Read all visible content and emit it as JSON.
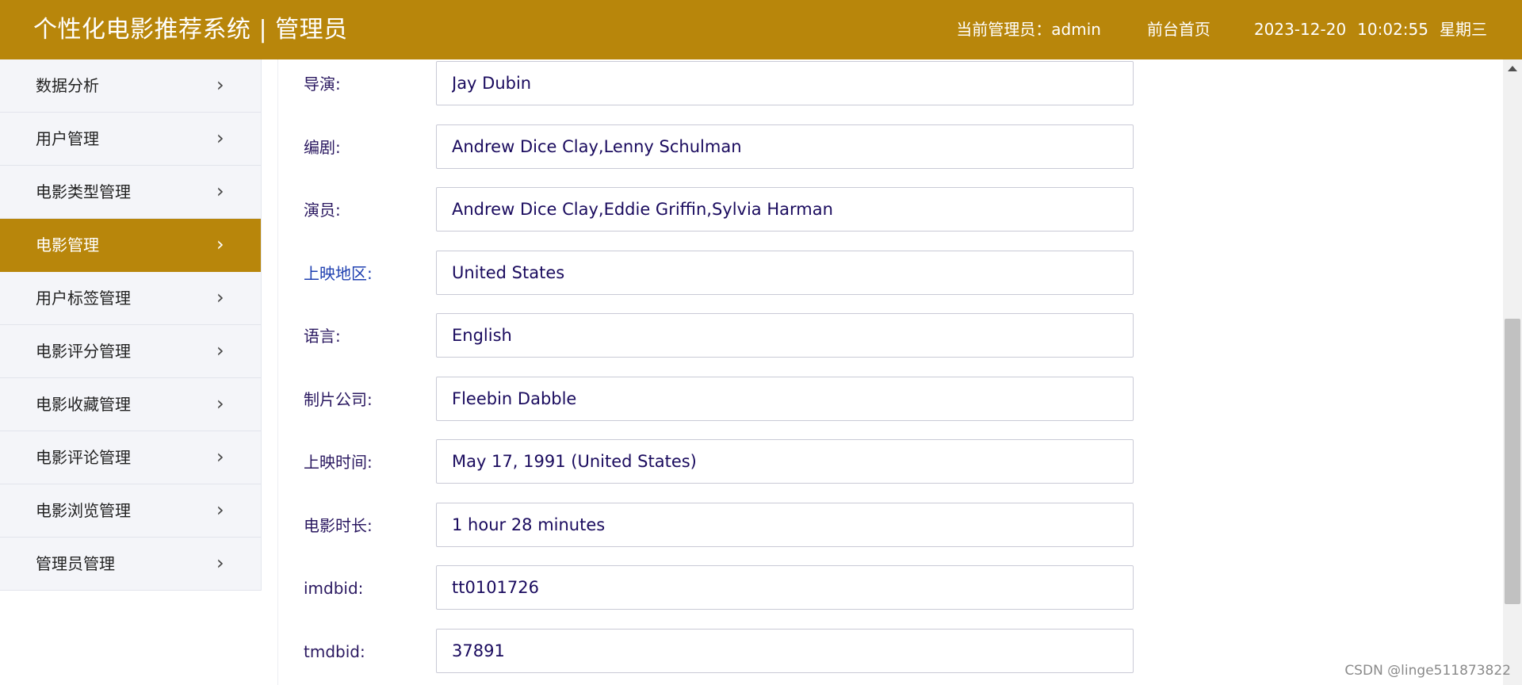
{
  "header": {
    "title": "个性化电影推荐系统 | 管理员",
    "admin_info": "当前管理员：admin",
    "home_link": "前台首页",
    "date": "2023-12-20",
    "time": "10:02:55",
    "weekday": "星期三"
  },
  "sidebar": {
    "items": [
      {
        "label": "数据分析"
      },
      {
        "label": "用户管理"
      },
      {
        "label": "电影类型管理"
      },
      {
        "label": "电影管理",
        "active": true
      },
      {
        "label": "用户标签管理"
      },
      {
        "label": "电影评分管理"
      },
      {
        "label": "电影收藏管理"
      },
      {
        "label": "电影评论管理"
      },
      {
        "label": "电影浏览管理"
      },
      {
        "label": "管理员管理"
      }
    ],
    "chevron": "›"
  },
  "form": {
    "fields": [
      {
        "label": "导演:",
        "value": "Jay Dubin"
      },
      {
        "label": "编剧:",
        "value": "Andrew Dice Clay,Lenny Schulman"
      },
      {
        "label": "演员:",
        "value": "Andrew Dice Clay,Eddie Griffin,Sylvia Harman"
      },
      {
        "label": "上映地区:",
        "value": "United States"
      },
      {
        "label": "语言:",
        "value": "English"
      },
      {
        "label": "制片公司:",
        "value": "Fleebin Dabble"
      },
      {
        "label": "上映时间:",
        "value": "May 17, 1991 (United States)"
      },
      {
        "label": "电影时长:",
        "value": "1 hour 28 minutes"
      },
      {
        "label": "imdbid:",
        "value": "tt0101726"
      },
      {
        "label": "tmdbid:",
        "value": "37891"
      }
    ]
  },
  "watermark": "CSDN @linge511873822",
  "colors": {
    "accent": "#b8860b",
    "label_text": "#2a1860",
    "value_text": "#1a0b5e"
  },
  "icons": {
    "menu_chevron": "chevron-right-icon",
    "scroll_up": "scroll-up-arrow-icon"
  }
}
